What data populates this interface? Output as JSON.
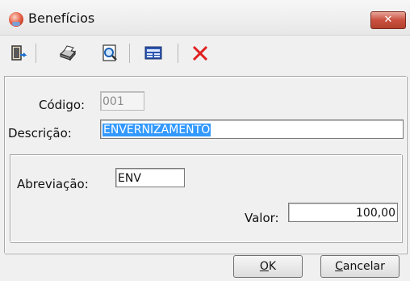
{
  "window": {
    "title": "Benefícios",
    "close_label": "✕"
  },
  "toolbar": {
    "buttons": [
      {
        "name": "exit-icon"
      },
      {
        "name": "print-icon"
      },
      {
        "name": "preview-icon"
      },
      {
        "name": "report-icon"
      },
      {
        "name": "delete-icon"
      }
    ]
  },
  "form": {
    "codigo_label": "Código:",
    "codigo_value": "001",
    "descricao_label": "Descrição:",
    "descricao_value": "ENVERNIZAMENTO",
    "abreviacao_label": "Abreviação:",
    "abreviacao_value": "ENV",
    "valor_label": "Valor:",
    "valor_value": "100,00"
  },
  "buttons": {
    "ok_mnemonic": "O",
    "ok_rest": "K",
    "cancel_mnemonic": "C",
    "cancel_rest": "ancelar"
  },
  "colors": {
    "selection": "#3399ff",
    "close_button": "#c9503e",
    "delete_x": "#e02020"
  }
}
